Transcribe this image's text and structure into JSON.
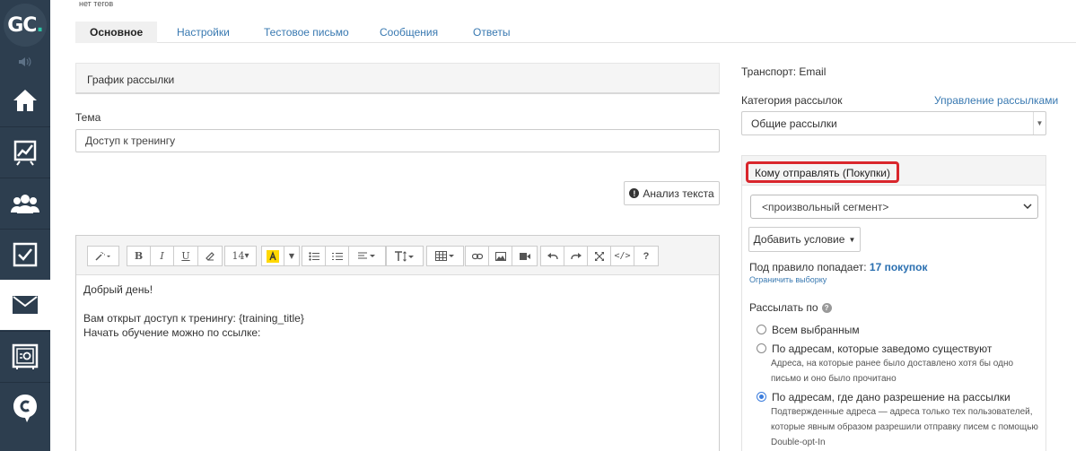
{
  "sidebar": {
    "logo_text": "GC",
    "logo_dot": ".",
    "items": [
      {
        "name": "home-icon"
      },
      {
        "name": "chart-icon"
      },
      {
        "name": "users-icon"
      },
      {
        "name": "tasks-icon"
      },
      {
        "name": "mail-icon"
      },
      {
        "name": "safe-icon"
      },
      {
        "name": "chat-icon"
      }
    ]
  },
  "header": {
    "tags_note": "нет тегов"
  },
  "tabs": [
    {
      "label": "Основное",
      "active": true
    },
    {
      "label": "Настройки"
    },
    {
      "label": "Тестовое письмо"
    },
    {
      "label": "Сообщения"
    },
    {
      "label": "Ответы"
    }
  ],
  "left": {
    "schedule_title": "График рассылки",
    "subject_label": "Тема",
    "subject_value": "Доступ к тренингу",
    "analyze_label": "Анализ текста",
    "font_size": "14",
    "editor_lines": [
      "Добрый день!",
      "",
      "Вам открыт доступ к тренингу: {training_title}",
      "Начать обучение можно по ссылке:"
    ]
  },
  "right": {
    "transport": "Транспорт: Email",
    "category_label": "Категория рассылок",
    "manage_link": "Управление рассылками",
    "category_value": "Общие рассылки",
    "who_title": "Кому отправлять (Покупки)",
    "segment_value": "<произвольный сегмент>",
    "add_condition": "Добавить условие",
    "rule_text": "Под правило попадает:",
    "rule_count": "17 покупок",
    "limit_link": "Ограничить выборку",
    "send_by_label": "Рассылать по",
    "options": [
      {
        "label": "Всем выбранным",
        "desc": ""
      },
      {
        "label": "По адресам, которые заведомо существуют",
        "desc": "Адреса, на которые ранее было доставлено хотя бы одно письмо и оно было прочитано"
      },
      {
        "label": "По адресам, где дано разрешение на рассылки",
        "desc": "Подтвержденные адреса — адреса только тех пользователей, которые явным образом разрешили отправку писем с помощью Double-opt-In",
        "checked": true
      }
    ]
  },
  "colors": {
    "sidebar": "#2d3e4f",
    "link": "#3979b1",
    "highlight": "#d9262c",
    "logo_accent": "#2bc4a6"
  }
}
